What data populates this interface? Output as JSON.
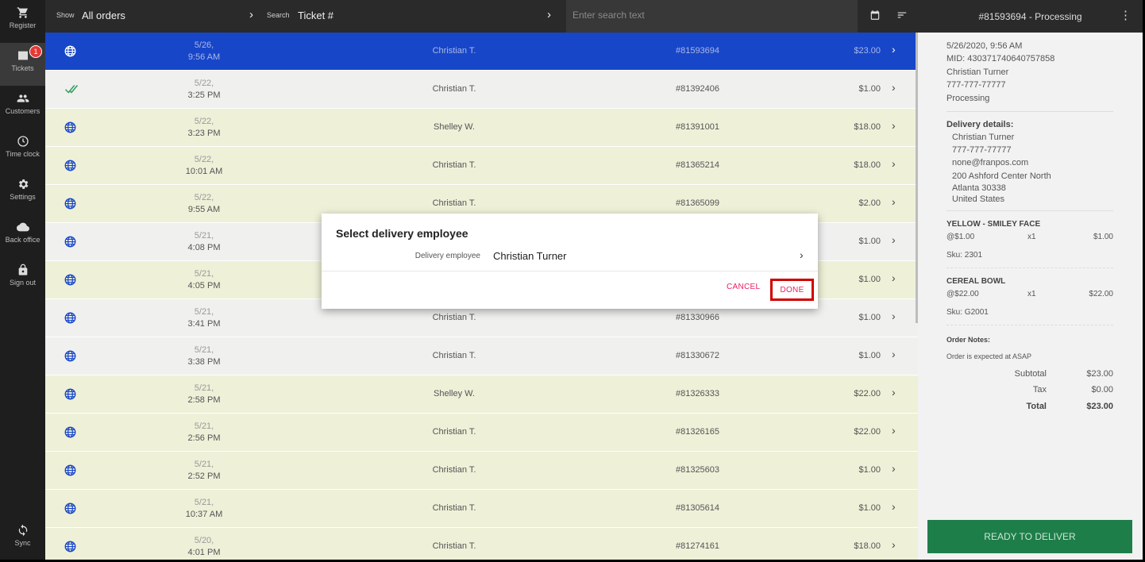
{
  "sidebar": {
    "items": [
      {
        "label": "Register",
        "icon": "cart-icon"
      },
      {
        "label": "Tickets",
        "icon": "ticket-icon",
        "badge": "1"
      },
      {
        "label": "Customers",
        "icon": "customers-icon"
      },
      {
        "label": "Time clock",
        "icon": "clock-icon"
      },
      {
        "label": "Settings",
        "icon": "gear-icon"
      },
      {
        "label": "Back office",
        "icon": "cloud-icon"
      },
      {
        "label": "Sign out",
        "icon": "lock-icon"
      }
    ],
    "sync_label": "Sync"
  },
  "topbar": {
    "show_label": "Show",
    "show_value": "All orders",
    "search_label": "Search",
    "search_value": "Ticket #",
    "search_placeholder": "Enter search text"
  },
  "tickets": [
    {
      "date": "5/26,",
      "time": "9:56 AM",
      "customer": "Christian T.",
      "id": "#81593694",
      "amount": "$23.00",
      "icon": "globe",
      "style": "selected"
    },
    {
      "date": "5/22,",
      "time": "3:25 PM",
      "customer": "Christian T.",
      "id": "#81392406",
      "amount": "$1.00",
      "icon": "check",
      "style": "white"
    },
    {
      "date": "5/22,",
      "time": "3:23 PM",
      "customer": "Shelley W.",
      "id": "#81391001",
      "amount": "$18.00",
      "icon": "globe",
      "style": "yellow"
    },
    {
      "date": "5/22,",
      "time": "10:01 AM",
      "customer": "Christian T.",
      "id": "#81365214",
      "amount": "$18.00",
      "icon": "globe",
      "style": "yellow"
    },
    {
      "date": "5/22,",
      "time": "9:55 AM",
      "customer": "Christian T.",
      "id": "#81365099",
      "amount": "$2.00",
      "icon": "globe",
      "style": "yellow"
    },
    {
      "date": "5/21,",
      "time": "4:08 PM",
      "customer": "",
      "id": "",
      "amount": "$1.00",
      "icon": "globe",
      "style": "white"
    },
    {
      "date": "5/21,",
      "time": "4:05 PM",
      "customer": "",
      "id": "",
      "amount": "$1.00",
      "icon": "globe",
      "style": "yellow"
    },
    {
      "date": "5/21,",
      "time": "3:41 PM",
      "customer": "Christian T.",
      "id": "#81330966",
      "amount": "$1.00",
      "icon": "globe",
      "style": "white"
    },
    {
      "date": "5/21,",
      "time": "3:38 PM",
      "customer": "Christian T.",
      "id": "#81330672",
      "amount": "$1.00",
      "icon": "globe",
      "style": "white"
    },
    {
      "date": "5/21,",
      "time": "2:58 PM",
      "customer": "Shelley W.",
      "id": "#81326333",
      "amount": "$22.00",
      "icon": "globe",
      "style": "yellow"
    },
    {
      "date": "5/21,",
      "time": "2:56 PM",
      "customer": "Christian T.",
      "id": "#81326165",
      "amount": "$22.00",
      "icon": "globe",
      "style": "yellow"
    },
    {
      "date": "5/21,",
      "time": "2:52 PM",
      "customer": "Christian T.",
      "id": "#81325603",
      "amount": "$1.00",
      "icon": "globe",
      "style": "yellow"
    },
    {
      "date": "5/21,",
      "time": "10:37 AM",
      "customer": "Christian T.",
      "id": "#81305614",
      "amount": "$1.00",
      "icon": "globe",
      "style": "yellow"
    },
    {
      "date": "5/20,",
      "time": "4:01 PM",
      "customer": "Christian T.",
      "id": "#81274161",
      "amount": "$18.00",
      "icon": "globe",
      "style": "yellow"
    }
  ],
  "detail": {
    "header": "#81593694 - Processing",
    "datetime": "5/26/2020, 9:56 AM",
    "mid": "MID: 430371740640757858",
    "name": "Christian Turner",
    "phone": "777-777-77777",
    "status": "Processing",
    "delivery_title": "Delivery details:",
    "delivery_name": "Christian Turner",
    "delivery_phone": "777-777-77777",
    "delivery_email": "none@franpos.com",
    "delivery_street": "200 Ashford Center North",
    "delivery_city": "Atlanta 30338",
    "delivery_country": "United States",
    "items": [
      {
        "name": "YELLOW - SMILEY FACE",
        "price": "@$1.00",
        "qty": "x1",
        "total": "$1.00",
        "sku": "Sku: 2301"
      },
      {
        "name": "CEREAL BOWL",
        "price": "@$22.00",
        "qty": "x1",
        "total": "$22.00",
        "sku": "Sku: G2001"
      }
    ],
    "notes_title": "Order Notes:",
    "notes": "Order is expected at ASAP",
    "subtotal_label": "Subtotal",
    "subtotal": "$23.00",
    "tax_label": "Tax",
    "tax": "$0.00",
    "total_label": "Total",
    "total": "$23.00",
    "action_button": "READY TO DELIVER"
  },
  "dialog": {
    "title": "Select delivery employee",
    "field_label": "Delivery employee",
    "field_value": "Christian Turner",
    "cancel_label": "CANCEL",
    "done_label": "DONE"
  },
  "colors": {
    "selected_row": "#1746c8",
    "yellow_row": "#eef0d8",
    "accent_pink": "#e91e63",
    "highlight_red": "#d00000",
    "action_green": "#1e7e4a"
  }
}
